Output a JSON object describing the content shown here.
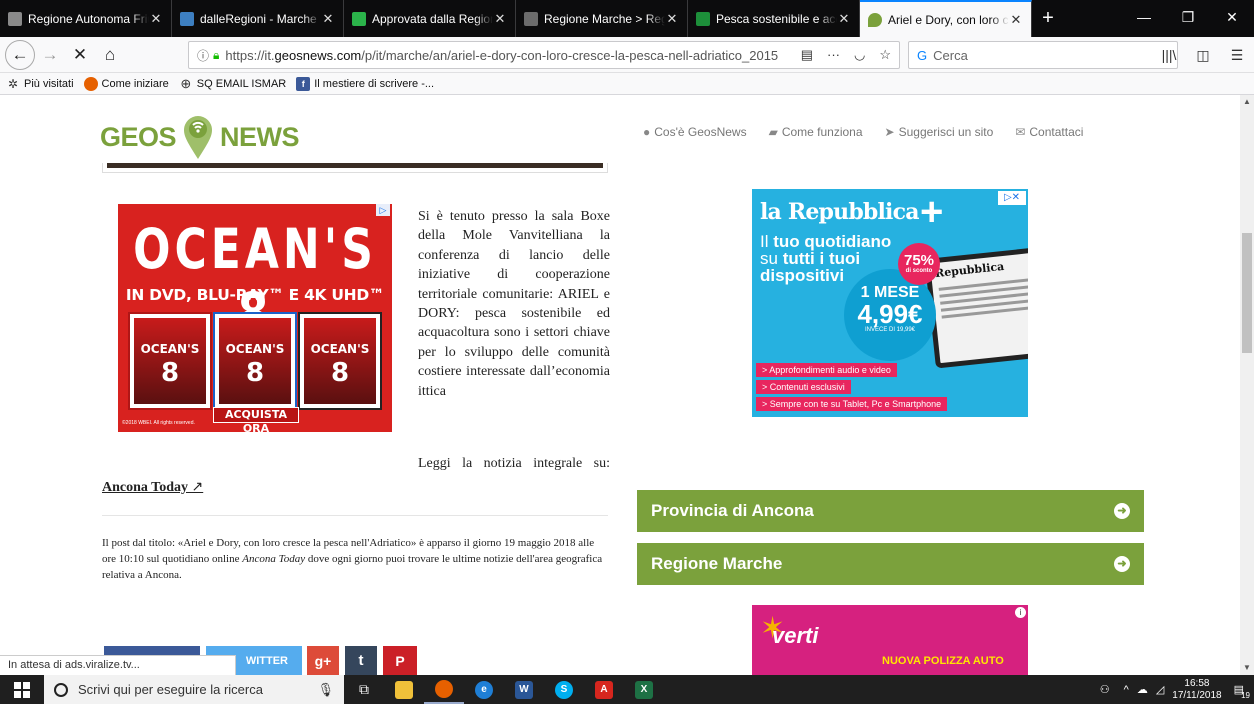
{
  "browser": {
    "tabs": [
      {
        "label": "Regione Autonoma Friuli",
        "favicon_color": "#8a8a8a",
        "active": false
      },
      {
        "label": "dalleRegioni - Marche -",
        "favicon_color": "#3d7fc1",
        "active": false
      },
      {
        "label": "Approvata dalla Regione",
        "favicon_color": "#2bb34a",
        "active": false
      },
      {
        "label": "Regione Marche > Regio",
        "favicon_color": "#6c6c6c",
        "active": false
      },
      {
        "label": "Pesca sostenibile e acqu",
        "favicon_color": "#1d8f3a",
        "active": false
      },
      {
        "label": "Ariel e Dory, con loro cre",
        "favicon_color": "#7ba13c",
        "active": true
      }
    ],
    "url_prefix": "https://it.",
    "url_domain": "geosnews.com",
    "url_path": "/p/it/marche/an/ariel-e-dory-con-loro-cresce-la-pesca-nell-adriatico_2015",
    "search_placeholder": "Cerca",
    "bookmarks": [
      {
        "label": "Più visitati",
        "icon": "gear-icon"
      },
      {
        "label": "Come iniziare",
        "icon": "firefox-icon"
      },
      {
        "label": "SQ EMAIL ISMAR",
        "icon": "globe-icon"
      },
      {
        "label": "Il mestiere di scrivere -...",
        "icon": "facebook-icon"
      }
    ],
    "status_text": "In attesa di ads.viralize.tv..."
  },
  "site": {
    "logo_left": "GEOS",
    "logo_right": "NEWS",
    "nav": [
      {
        "label": "Cos'è GeosNews",
        "icon": "info-icon"
      },
      {
        "label": "Come funziona",
        "icon": "book-icon"
      },
      {
        "label": "Suggerisci un sito",
        "icon": "send-icon"
      },
      {
        "label": "Contattaci",
        "icon": "envelope-icon"
      }
    ]
  },
  "ad_ocean": {
    "title": "OCEAN'S 8",
    "subtitle": "IN DVD, BLU-RAY™ E 4K UHD™",
    "cover_title": "OCEAN'S",
    "cover_number": "8",
    "cta": "ACQUISTA ORA",
    "copyright": "©2018 WBEI. All rights reserved."
  },
  "article": {
    "body": "Si è tenuto presso la sala Boxe della Mole Vanvitelliana la conferenza di lancio delle iniziative di cooperazione territoriale comunitarie: ARIEL e DORY: pesca sostenibile ed acquacoltura sono i settori chiave per lo sviluppo delle comunità costiere interessate dall’economia ittica",
    "read_more": "Leggi la notizia integrale su:",
    "source": "Ancona Today",
    "post_text_1": "Il post dal titolo: «Ariel e Dory, con loro cresce la pesca nell'Adriatico» è apparso il giorno 19 maggio 2018  alle ore 10:10 sul quotidiano online ",
    "post_text_source": "Ancona Today",
    "post_text_2": " dove ogni giorno puoi trovare le ultime notizie dell'area geografica relativa a Ancona.",
    "share_twitter": "WITTER",
    "share_gplus": "g+",
    "share_tumblr": "t",
    "share_pinterest": "P"
  },
  "ad_repubblica": {
    "logo": "la Repubblica",
    "line1_a": "Il ",
    "line1_b": "tuo quotidiano",
    "line2_a": "su ",
    "line2_b": "tutti i tuoi",
    "line3": "dispositivi",
    "badge": "75%",
    "badge_sub": "di sconto",
    "months": "1 MESE",
    "price": "4,99€",
    "old_price": "INVECE DI 19,99€",
    "tablet_title": "Repubblica",
    "bullets": [
      "> Approfondimenti audio e video",
      "> Contenuti esclusivi",
      "> Sempre con te su Tablet, Pc e Smartphone"
    ]
  },
  "categories": [
    {
      "label": "Provincia di Ancona"
    },
    {
      "label": "Regione Marche"
    }
  ],
  "ad_verti": {
    "brand": "verti",
    "tagline": "NUOVA POLIZZA AUTO"
  },
  "taskbar": {
    "search_placeholder": "Scrivi qui per eseguire la ricerca",
    "time": "16:58",
    "date": "17/11/2018",
    "notification_count": "19"
  },
  "colors": {
    "brand_green": "#7ba13c",
    "ad_red": "#d8221f",
    "rep_blue": "#26b1e0",
    "rep_pink": "#e8265e",
    "accent_blue": "#0a84ff"
  }
}
